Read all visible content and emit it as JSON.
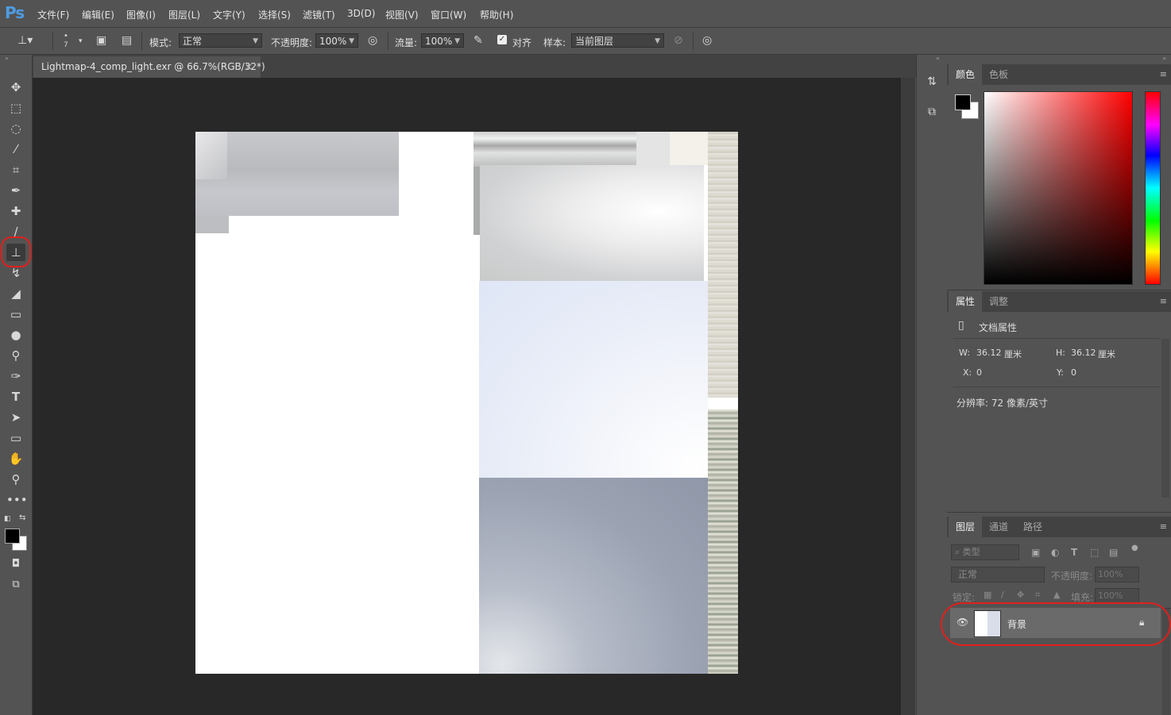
{
  "app": {
    "logo": "Ps"
  },
  "menu": [
    "文件(F)",
    "编辑(E)",
    "图像(I)",
    "图层(L)",
    "文字(Y)",
    "选择(S)",
    "滤镜(T)",
    "3D(D)",
    "视图(V)",
    "窗口(W)",
    "帮助(H)"
  ],
  "options": {
    "brush_size": "7",
    "mode_label": "模式:",
    "mode_value": "正常",
    "opacity_label": "不透明度:",
    "opacity_value": "100%",
    "flow_label": "流量:",
    "flow_value": "100%",
    "align_label": "对齐",
    "align_checked": true,
    "sample_label": "样本:",
    "sample_value": "当前图层"
  },
  "document": {
    "tab_title": "Lightmap-4_comp_light.exr @ 66.7%(RGB/32*)",
    "close": "×"
  },
  "tools": [
    "move-tool-icon",
    "marquee-tool-icon",
    "lasso-tool-icon",
    "quick-select-tool-icon",
    "crop-tool-icon",
    "eyedropper-tool-icon",
    "healing-brush-tool-icon",
    "brush-tool-icon",
    "clone-stamp-tool-icon",
    "history-brush-tool-icon",
    "eraser-tool-icon",
    "gradient-tool-icon",
    "blur-tool-icon",
    "dodge-tool-icon",
    "pen-tool-icon",
    "type-tool-icon",
    "path-select-tool-icon",
    "rectangle-tool-icon",
    "hand-tool-icon",
    "zoom-tool-icon",
    "more-tools-icon"
  ],
  "active_tool": "clone-stamp-tool-icon",
  "annotation_color": "#e0201c",
  "color_panel": {
    "tabs": [
      "颜色",
      "色板"
    ],
    "foreground": "#000000",
    "background": "#ffffff",
    "hue": "#ff0000"
  },
  "properties_panel": {
    "tabs": [
      "属性",
      "调整"
    ],
    "title": "文档属性",
    "w_label": "W:",
    "w_value": "36.12",
    "w_unit": "厘米",
    "h_label": "H:",
    "h_value": "36.12",
    "h_unit": "厘米",
    "x_label": "X:",
    "x_value": "0",
    "y_label": "Y:",
    "y_value": "0",
    "resolution": "分辨率: 72 像素/英寸"
  },
  "layers_panel": {
    "tabs": [
      "图层",
      "通道",
      "路径"
    ],
    "filter_placeholder": "类型",
    "blend_mode": "正常",
    "opacity_label": "不透明度:",
    "opacity_value": "100%",
    "lock_label": "锁定:",
    "fill_label": "填充:",
    "fill_value": "100%",
    "layers": [
      {
        "name": "背景",
        "visible": true,
        "locked": true
      }
    ]
  }
}
